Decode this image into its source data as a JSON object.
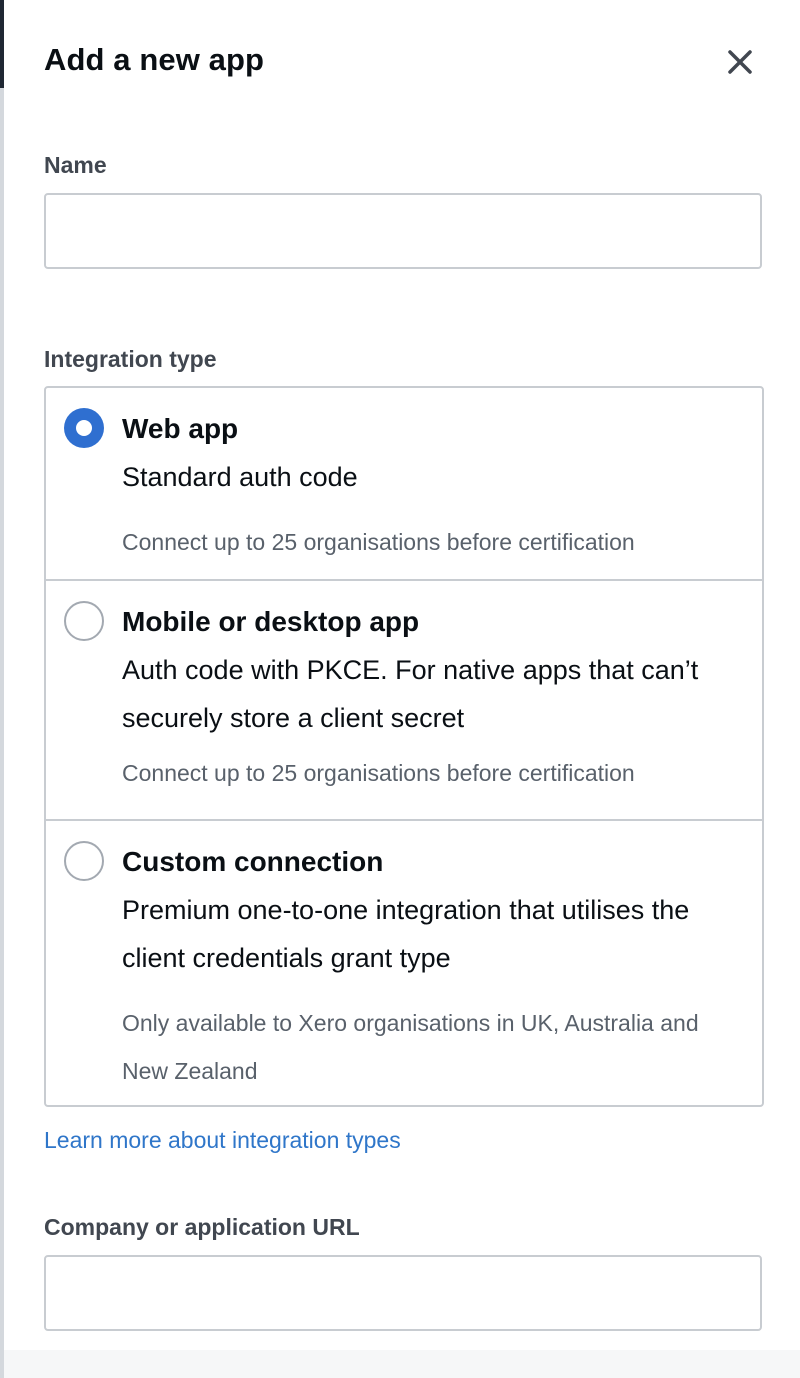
{
  "dialog": {
    "title": "Add a new app",
    "close_icon": "close-icon"
  },
  "form": {
    "name": {
      "label": "Name",
      "value": "",
      "placeholder": ""
    },
    "integration_type": {
      "label": "Integration type",
      "selected": "web-app",
      "options": [
        {
          "id": "web-app",
          "title": "Web app",
          "description": "Standard auth code",
          "note": "Connect up to 25 organisations before certification",
          "checked": true
        },
        {
          "id": "mobile-desktop-app",
          "title": "Mobile or desktop app",
          "description": "Auth code with PKCE. For native apps that can’t securely store a client secret",
          "note": "Connect up to 25 organisations before certification",
          "checked": false
        },
        {
          "id": "custom-connection",
          "title": "Custom connection",
          "description": "Premium one-to-one integration that utilises the client credentials grant type",
          "note": "Only available to Xero organisations in UK, Australia and New Zealand",
          "checked": false
        }
      ],
      "learn_more_link": "Learn more about integration types"
    },
    "company_url": {
      "label": "Company or application URL",
      "value": "",
      "placeholder": ""
    }
  },
  "colors": {
    "accent": "#2f6fd0",
    "link": "#2f76c9",
    "border": "#c8ccd1",
    "label": "#414750",
    "muted_text": "#59616b"
  }
}
